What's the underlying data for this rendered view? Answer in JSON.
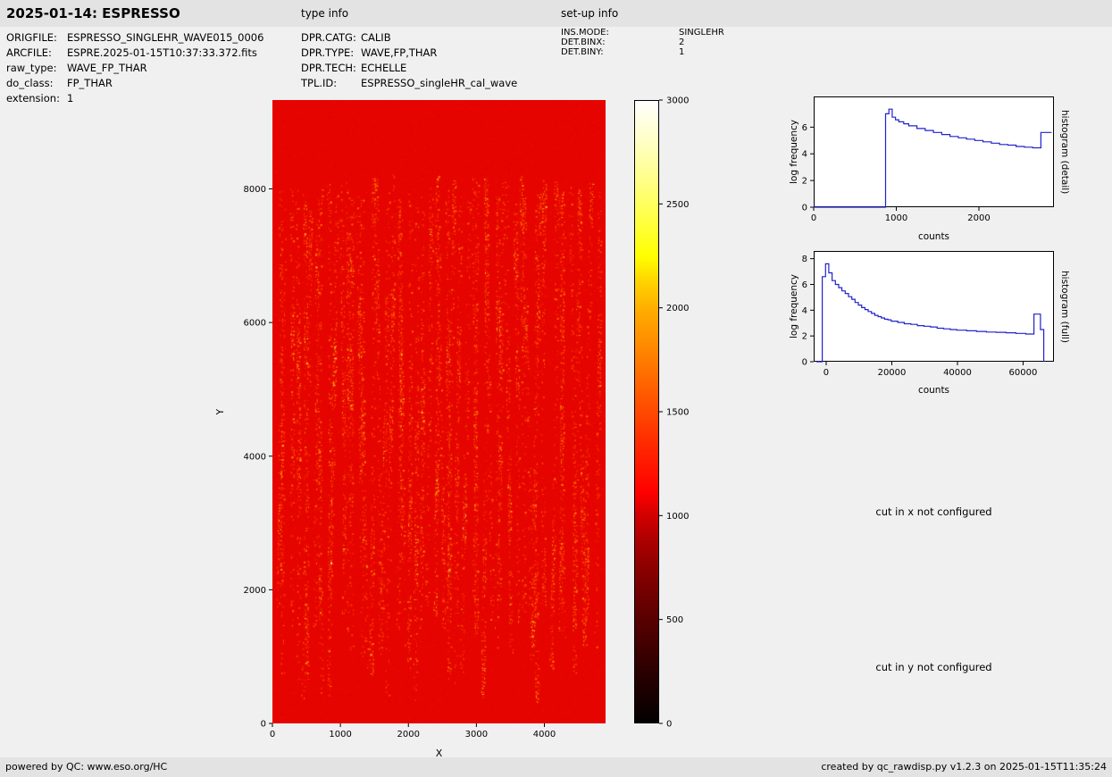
{
  "header": {
    "title": "2025-01-14: ESPRESSO",
    "type_info_label": "type info",
    "setup_info_label": "set-up info"
  },
  "file_info": {
    "rows": [
      {
        "label": "ORIGFILE:",
        "value": "ESPRESSO_SINGLEHR_WAVE015_0006"
      },
      {
        "label": "ARCFILE:",
        "value": "ESPRE.2025-01-15T10:37:33.372.fits"
      },
      {
        "label": "raw_type:",
        "value": "WAVE_FP_THAR"
      },
      {
        "label": "do_class:",
        "value": "FP_THAR"
      },
      {
        "label": "extension:",
        "value": "1"
      }
    ]
  },
  "type_info": {
    "rows": [
      {
        "label": "DPR.CATG:",
        "value": "CALIB"
      },
      {
        "label": "DPR.TYPE:",
        "value": "WAVE,FP,THAR"
      },
      {
        "label": "DPR.TECH:",
        "value": "ECHELLE"
      },
      {
        "label": "TPL.ID:",
        "value": "ESPRESSO_singleHR_cal_wave"
      }
    ]
  },
  "setup_info": {
    "rows": [
      {
        "label": "INS.MODE:",
        "value": "SINGLEHR"
      },
      {
        "label": "DET.BINX:",
        "value": "2"
      },
      {
        "label": "DET.BINY:",
        "value": "1"
      }
    ]
  },
  "messages": {
    "cut_x": "cut in x not configured",
    "cut_y": "cut in y not configured"
  },
  "footer": {
    "left": "powered by QC: www.eso.org/HC",
    "right": "created by qc_rawdisp.py v1.2.3 on 2025-01-15T11:35:24"
  },
  "chart_data": [
    {
      "id": "raw-image",
      "type": "heatmap",
      "title": "",
      "xlabel": "X",
      "ylabel": "Y",
      "xlim": [
        0,
        4900
      ],
      "ylim": [
        0,
        9330
      ],
      "xticks": [
        0,
        1000,
        2000,
        3000,
        4000
      ],
      "yticks": [
        0,
        2000,
        4000,
        6000,
        8000
      ],
      "colormap": "hot",
      "colorbar": {
        "vmin": 0,
        "vmax": 3000,
        "ticks": [
          0,
          500,
          1000,
          1500,
          2000,
          2500,
          3000
        ]
      },
      "background_value": 1000,
      "speckle_region_y": [
        1300,
        8250
      ],
      "description": "ESPRESSO raw WAVE_FP_THAR frame: uniform red background near 1000 counts with dotted curved vertical echelle-order traces of brighter orange/yellow/white emission spots between y=1300 and y=8250"
    },
    {
      "id": "histogram-detail",
      "type": "line",
      "right_label": "histogram (detail)",
      "xlabel": "counts",
      "ylabel": "log frequency",
      "xlim": [
        0,
        2908
      ],
      "ylim": [
        0,
        8.3
      ],
      "xticks": [
        0,
        1000,
        2000
      ],
      "yticks": [
        0,
        2,
        4,
        6
      ],
      "line_color": "#2222cc",
      "points": [
        [
          0,
          0
        ],
        [
          870,
          0
        ],
        [
          870,
          7.0
        ],
        [
          910,
          7.0
        ],
        [
          910,
          7.35
        ],
        [
          950,
          7.35
        ],
        [
          950,
          6.75
        ],
        [
          990,
          6.75
        ],
        [
          990,
          6.55
        ],
        [
          1030,
          6.55
        ],
        [
          1030,
          6.4
        ],
        [
          1090,
          6.4
        ],
        [
          1090,
          6.25
        ],
        [
          1150,
          6.25
        ],
        [
          1150,
          6.1
        ],
        [
          1250,
          6.1
        ],
        [
          1250,
          5.9
        ],
        [
          1350,
          5.9
        ],
        [
          1350,
          5.75
        ],
        [
          1450,
          5.75
        ],
        [
          1450,
          5.6
        ],
        [
          1550,
          5.6
        ],
        [
          1550,
          5.45
        ],
        [
          1650,
          5.45
        ],
        [
          1650,
          5.3
        ],
        [
          1750,
          5.3
        ],
        [
          1750,
          5.2
        ],
        [
          1850,
          5.2
        ],
        [
          1850,
          5.1
        ],
        [
          1950,
          5.1
        ],
        [
          1950,
          5.0
        ],
        [
          2050,
          5.0
        ],
        [
          2050,
          4.9
        ],
        [
          2150,
          4.9
        ],
        [
          2150,
          4.8
        ],
        [
          2250,
          4.8
        ],
        [
          2250,
          4.7
        ],
        [
          2350,
          4.7
        ],
        [
          2350,
          4.65
        ],
        [
          2450,
          4.65
        ],
        [
          2450,
          4.55
        ],
        [
          2550,
          4.55
        ],
        [
          2550,
          4.5
        ],
        [
          2650,
          4.5
        ],
        [
          2650,
          4.45
        ],
        [
          2750,
          4.45
        ],
        [
          2750,
          5.6
        ],
        [
          2880,
          5.6
        ]
      ]
    },
    {
      "id": "histogram-full",
      "type": "line",
      "right_label": "histogram (full)",
      "xlabel": "counts",
      "ylabel": "log frequency",
      "xlim": [
        -3810,
        69400
      ],
      "ylim": [
        0,
        8.6
      ],
      "xticks": [
        0,
        20000,
        40000,
        60000
      ],
      "yticks": [
        0,
        2,
        4,
        6,
        8
      ],
      "line_color": "#2222cc",
      "points": [
        [
          -3000,
          0
        ],
        [
          -1200,
          0
        ],
        [
          -1200,
          6.6
        ],
        [
          -200,
          6.6
        ],
        [
          -200,
          7.6
        ],
        [
          800,
          7.6
        ],
        [
          800,
          6.9
        ],
        [
          1800,
          6.9
        ],
        [
          1800,
          6.3
        ],
        [
          2800,
          6.3
        ],
        [
          2800,
          6.0
        ],
        [
          3800,
          6.0
        ],
        [
          3800,
          5.75
        ],
        [
          4800,
          5.75
        ],
        [
          4800,
          5.5
        ],
        [
          5800,
          5.5
        ],
        [
          5800,
          5.3
        ],
        [
          6800,
          5.3
        ],
        [
          6800,
          5.05
        ],
        [
          7800,
          5.05
        ],
        [
          7800,
          4.85
        ],
        [
          8800,
          4.85
        ],
        [
          8800,
          4.6
        ],
        [
          9800,
          4.6
        ],
        [
          9800,
          4.4
        ],
        [
          10800,
          4.4
        ],
        [
          10800,
          4.2
        ],
        [
          11800,
          4.2
        ],
        [
          11800,
          4.05
        ],
        [
          12800,
          4.05
        ],
        [
          12800,
          3.9
        ],
        [
          13800,
          3.9
        ],
        [
          13800,
          3.75
        ],
        [
          14800,
          3.75
        ],
        [
          14800,
          3.6
        ],
        [
          15800,
          3.6
        ],
        [
          15800,
          3.5
        ],
        [
          16800,
          3.5
        ],
        [
          16800,
          3.4
        ],
        [
          17800,
          3.4
        ],
        [
          17800,
          3.3
        ],
        [
          18800,
          3.3
        ],
        [
          18800,
          3.25
        ],
        [
          19800,
          3.25
        ],
        [
          19800,
          3.15
        ],
        [
          21800,
          3.15
        ],
        [
          21800,
          3.05
        ],
        [
          23800,
          3.05
        ],
        [
          23800,
          2.95
        ],
        [
          25800,
          2.95
        ],
        [
          25800,
          2.9
        ],
        [
          27800,
          2.9
        ],
        [
          27800,
          2.8
        ],
        [
          29800,
          2.8
        ],
        [
          29800,
          2.75
        ],
        [
          31800,
          2.75
        ],
        [
          31800,
          2.7
        ],
        [
          33800,
          2.7
        ],
        [
          33800,
          2.6
        ],
        [
          35800,
          2.6
        ],
        [
          35800,
          2.55
        ],
        [
          37800,
          2.55
        ],
        [
          37800,
          2.5
        ],
        [
          39800,
          2.5
        ],
        [
          39800,
          2.45
        ],
        [
          42800,
          2.45
        ],
        [
          42800,
          2.4
        ],
        [
          45800,
          2.4
        ],
        [
          45800,
          2.35
        ],
        [
          48800,
          2.35
        ],
        [
          48800,
          2.3
        ],
        [
          51800,
          2.3
        ],
        [
          51800,
          2.28
        ],
        [
          54800,
          2.28
        ],
        [
          54800,
          2.25
        ],
        [
          57800,
          2.25
        ],
        [
          57800,
          2.2
        ],
        [
          60800,
          2.2
        ],
        [
          60800,
          2.15
        ],
        [
          63300,
          2.15
        ],
        [
          63300,
          3.7
        ],
        [
          65300,
          3.7
        ],
        [
          65300,
          2.5
        ],
        [
          66300,
          2.5
        ],
        [
          66300,
          0
        ]
      ]
    }
  ]
}
